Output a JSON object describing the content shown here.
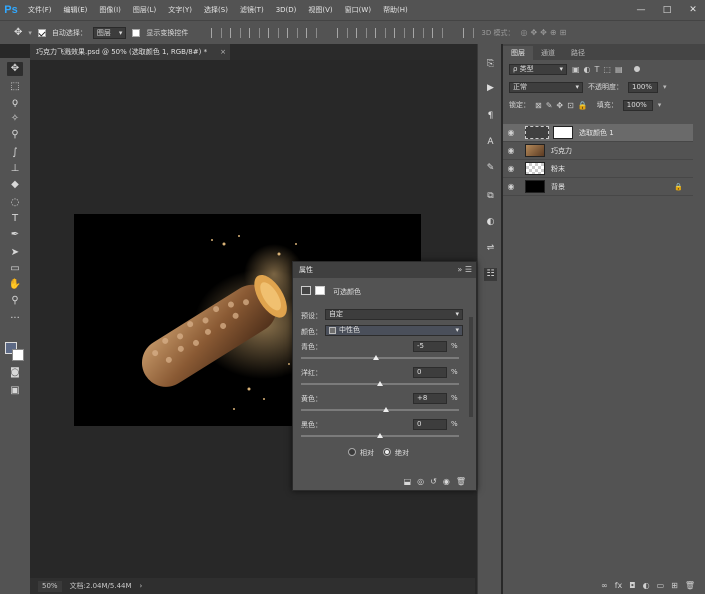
{
  "app": {
    "logo": "Ps"
  },
  "menu": [
    "文件(F)",
    "编辑(E)",
    "图像(I)",
    "图层(L)",
    "文字(Y)",
    "选择(S)",
    "滤镜(T)",
    "3D(D)",
    "视图(V)",
    "窗口(W)",
    "帮助(H)"
  ],
  "window_controls": {
    "minimize": "—",
    "restore": "□",
    "close": "✕"
  },
  "options": {
    "auto_select_label": "自动选择：",
    "auto_select_checked": true,
    "auto_select_value": "图层",
    "transform_label": "显示变换控件",
    "transform_checked": false,
    "mode_3d": "3D 模式："
  },
  "document": {
    "tab_title": "巧克力飞溅效果.psd @ 50% (选取颜色 1, RGB/8#) *",
    "tab_close": "×"
  },
  "status": {
    "zoom": "50%",
    "doc_info": "文档:2.04M/5.44M",
    "arrow": "›"
  },
  "layers_panel": {
    "tabs": [
      "图层",
      "通道",
      "路径"
    ],
    "filter_label": "ρ 类型",
    "blend_mode": "正常",
    "opacity_label": "不透明度：",
    "opacity_value": "100%",
    "lock_label": "锁定：",
    "fill_label": "填充：",
    "fill_value": "100%",
    "layers": [
      {
        "name": "选取颜色 1",
        "selected": true
      },
      {
        "name": "巧克力",
        "selected": false
      },
      {
        "name": "粉末",
        "selected": false
      },
      {
        "name": "背景",
        "selected": false
      }
    ]
  },
  "properties": {
    "panel_title": "属性",
    "title": "可选颜色",
    "preset_label": "预设：",
    "preset_value": "自定",
    "colors_label": "颜色：",
    "colors_value": "中性色",
    "sliders": [
      {
        "label": "青色：",
        "value": "-5",
        "unit": "%",
        "level": -5
      },
      {
        "label": "洋红：",
        "value": "0",
        "unit": "%",
        "level": 0
      },
      {
        "label": "黄色：",
        "value": "+8",
        "unit": "%",
        "level": 8
      },
      {
        "label": "黑色：",
        "value": "0",
        "unit": "%",
        "level": 0
      }
    ],
    "relative_label": "相对",
    "absolute_label": "绝对",
    "method": "绝对"
  },
  "colors": {
    "accent": "#31a8ff",
    "panel": "#535353",
    "canvas": "#282828"
  }
}
